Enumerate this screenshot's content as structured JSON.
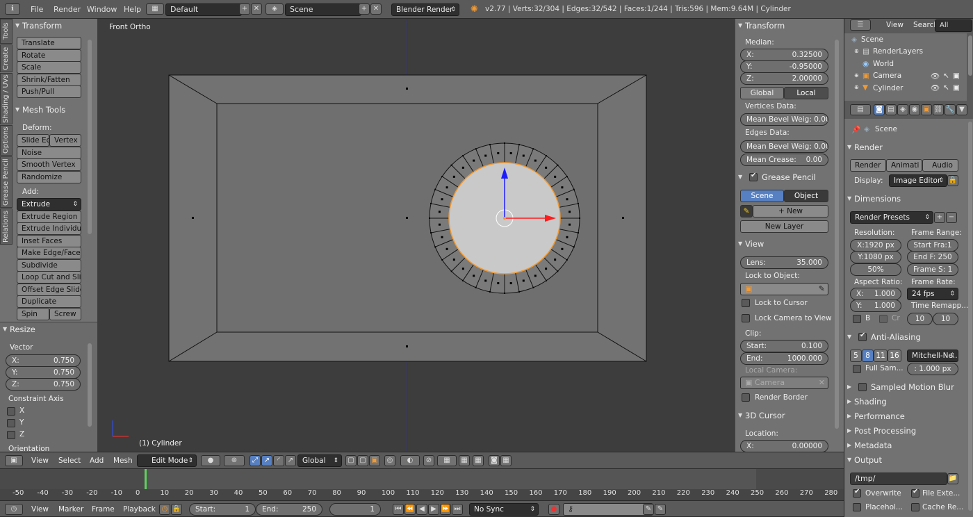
{
  "topbar": {
    "menus": [
      "File",
      "Render",
      "Window",
      "Help"
    ],
    "layout": "Default",
    "scene": "Scene",
    "engine": "Blender Render",
    "stats": "v2.77 | Verts:32/304 | Edges:32/542 | Faces:1/244 | Tris:596 | Mem:9.64M | Cylinder"
  },
  "tools": {
    "tabs": [
      "Tools",
      "Create",
      "Shading / UVs",
      "Options",
      "Grease Pencil",
      "Relations"
    ],
    "transform_title": "Transform",
    "transform": [
      "Translate",
      "Rotate",
      "Scale",
      "Shrink/Fatten",
      "Push/Pull"
    ],
    "mesh_title": "Mesh Tools",
    "deform_label": "Deform:",
    "slide_edge": "Slide Ed",
    "vertex": "Vertex",
    "deform": [
      "Noise",
      "Smooth Vertex",
      "Randomize"
    ],
    "add_label": "Add:",
    "extrude": "Extrude",
    "add": [
      "Extrude Region",
      "Extrude Individual",
      "Inset Faces",
      "Make Edge/Face",
      "Subdivide",
      "Loop Cut and Slide",
      "Offset Edge Slide",
      "Duplicate"
    ],
    "spin": "Spin",
    "screw": "Screw"
  },
  "resize": {
    "title": "Resize",
    "vector_label": "Vector",
    "x": "X:",
    "xv": "0.750",
    "y": "Y:",
    "yv": "0.750",
    "z": "Z:",
    "zv": "0.750",
    "constraint": "Constraint Axis",
    "ax": [
      "X",
      "Y",
      "Z"
    ],
    "orientation": "Orientation"
  },
  "viewport": {
    "view_name": "Front Ortho",
    "object": "(1) Cylinder"
  },
  "props": {
    "transform": "Transform",
    "median": "Median:",
    "x": "X:",
    "xv": "0.32500",
    "y": "Y:",
    "yv": "-0.95000",
    "z": "Z:",
    "zv": "2.00000",
    "global": "Global",
    "local": "Local",
    "vdata": "Vertices Data:",
    "vbevel": "Mean Bevel Weig: 0.00",
    "edata": "Edges Data:",
    "ebevel": "Mean Bevel Weig: 0.00",
    "crease": "Mean Crease:",
    "creasev": "0.00",
    "gp": "Grease Pencil",
    "scene": "Scene",
    "object": "Object",
    "new": "New",
    "newlayer": "New Layer",
    "view": "View",
    "lens": "Lens:",
    "lensv": "35.000",
    "lockobj": "Lock to Object:",
    "lockcursor": "Lock to Cursor",
    "lockcam": "Lock Camera to View",
    "clip": "Clip:",
    "start": "Start:",
    "startv": "0.100",
    "end": "End:",
    "endv": "1000.000",
    "localcam": "Local Camera:",
    "camera": "Camera",
    "border": "Render Border",
    "cursor": "3D Cursor",
    "location": "Location:",
    "cx": "X:",
    "cxv": "0.00000"
  },
  "outliner": {
    "menus": [
      "View",
      "Search"
    ],
    "allscenes": "All Scenes",
    "items": [
      "Scene",
      "RenderLayers",
      "World",
      "Camera",
      "Cylinder"
    ]
  },
  "render": {
    "scene": "Scene",
    "render": "Render",
    "btn_render": "Render",
    "btn_anim": "Animati",
    "btn_audio": "Audio",
    "display": "Display:",
    "display_v": "Image Editor",
    "dimensions": "Dimensions",
    "presets": "Render Presets",
    "resolution": "Resolution:",
    "resx": "X:1920 px",
    "resy": "Y:1080 px",
    "pct": "50%",
    "frange": "Frame Range:",
    "fstart": "Start Fra:1",
    "fend": "End F: 250",
    "fstep": "Frame S: 1",
    "aspect": "Aspect Ratio:",
    "ax": "X:",
    "axv": "1.000",
    "ay": "Y:",
    "ayv": "1.000",
    "b": "B",
    "cr": "Cr",
    "framerate": "Frame Rate:",
    "fps": "24 fps",
    "remap": "Time Remapp...",
    "r1": "10",
    "r2": "10",
    "aa": "Anti-Aliasing",
    "aav": [
      "5",
      "8",
      "11",
      "16"
    ],
    "filter": "Mitchell-Ne...",
    "full": "Full Sam...",
    "px": ": 1.000 px",
    "closed": [
      "Sampled Motion Blur",
      "Shading",
      "Performance",
      "Post Processing",
      "Metadata"
    ],
    "output": "Output",
    "path": "/tmp/",
    "overwrite": "Overwrite",
    "fileext": "File Exte...",
    "placeholder": "Placehol...",
    "cache": "Cache Re..."
  },
  "header3d": {
    "menus": [
      "View",
      "Select",
      "Add",
      "Mesh"
    ],
    "mode": "Edit Mode",
    "orient": "Global"
  },
  "timeline": {
    "ticks": [
      "-50",
      "-40",
      "-30",
      "-20",
      "-10",
      "0",
      "10",
      "20",
      "30",
      "40",
      "50",
      "60",
      "70",
      "80",
      "90",
      "100",
      "110",
      "120",
      "130",
      "140",
      "150",
      "160",
      "170",
      "180",
      "190",
      "200",
      "210",
      "220",
      "230",
      "240",
      "250",
      "260",
      "270",
      "280"
    ],
    "menus": [
      "View",
      "Marker",
      "Frame",
      "Playback"
    ],
    "start": "Start:",
    "startv": "1",
    "end": "End:",
    "endv": "250",
    "cur": "1",
    "sync": "No Sync"
  }
}
